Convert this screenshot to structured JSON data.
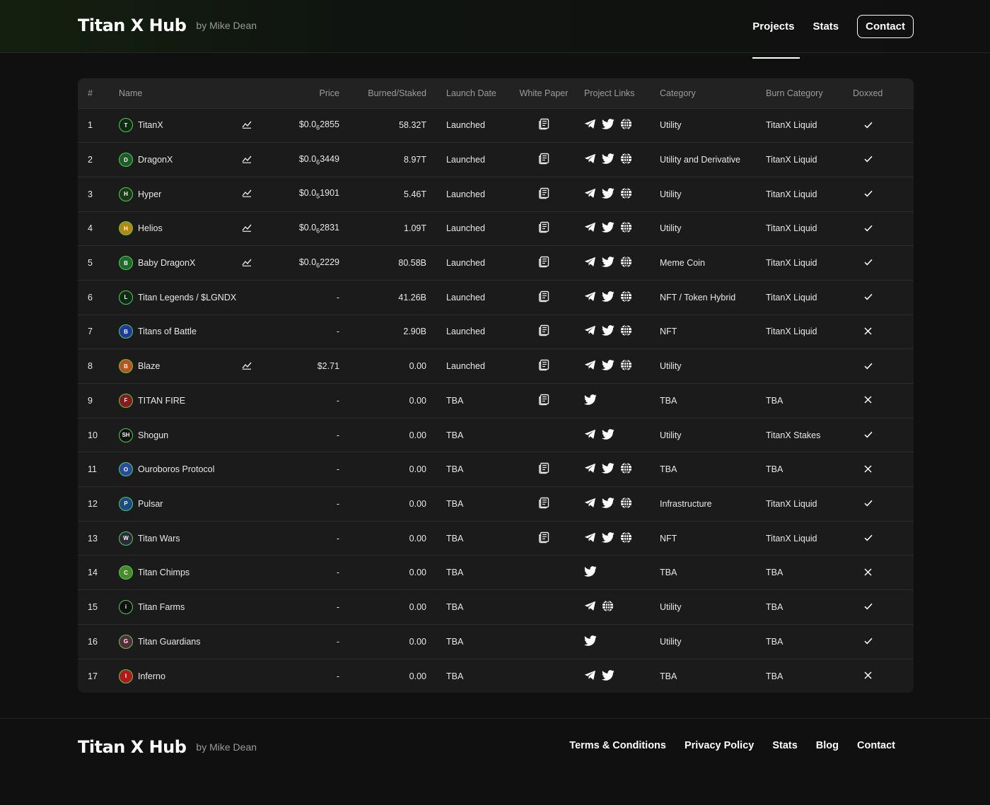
{
  "brand": {
    "name": "Titan X Hub",
    "by": "by Mike Dean"
  },
  "nav": {
    "projects": "Projects",
    "stats": "Stats",
    "contact": "Contact"
  },
  "table": {
    "headers": [
      "#",
      "Name",
      "Price",
      "Burned/Staked",
      "Launch Date",
      "White Paper",
      "Project Links",
      "Category",
      "Burn Category",
      "Doxxed"
    ],
    "rows": [
      {
        "n": "1",
        "name": "TitanX",
        "chart": true,
        "price_html": "$0.0<sub>6</sub>2855",
        "burned": "58.32T",
        "launch": "Launched",
        "wp": true,
        "links": [
          "telegram",
          "twitter",
          "globe"
        ],
        "category": "Utility",
        "burn": "TitanX Liquid",
        "doxxed": true,
        "logo": "T",
        "logo_bg": "#0f2a14"
      },
      {
        "n": "2",
        "name": "DragonX",
        "chart": true,
        "price_html": "$0.0<sub>6</sub>3449",
        "burned": "8.97T",
        "launch": "Launched",
        "wp": true,
        "links": [
          "telegram",
          "twitter",
          "globe"
        ],
        "category": "Utility and Derivative",
        "burn": "TitanX Liquid",
        "doxxed": true,
        "logo": "D",
        "logo_bg": "#1e5a2a"
      },
      {
        "n": "3",
        "name": "Hyper",
        "chart": true,
        "price_html": "$0.0<sub>5</sub>1901",
        "burned": "5.46T",
        "launch": "Launched",
        "wp": true,
        "links": [
          "telegram",
          "twitter",
          "globe"
        ],
        "category": "Utility",
        "burn": "TitanX Liquid",
        "doxxed": true,
        "logo": "H",
        "logo_bg": "#1a3a1a"
      },
      {
        "n": "4",
        "name": "Helios",
        "chart": true,
        "price_html": "$0.0<sub>6</sub>2831",
        "burned": "1.09T",
        "launch": "Launched",
        "wp": true,
        "links": [
          "telegram",
          "twitter",
          "globe"
        ],
        "category": "Utility",
        "burn": "TitanX Liquid",
        "doxxed": true,
        "logo": "H",
        "logo_bg": "#b8860b"
      },
      {
        "n": "5",
        "name": "Baby DragonX",
        "chart": true,
        "price_html": "$0.0<sub>6</sub>2229",
        "burned": "80.58B",
        "launch": "Launched",
        "wp": true,
        "links": [
          "telegram",
          "twitter",
          "globe"
        ],
        "category": "Meme Coin",
        "burn": "TitanX Liquid",
        "doxxed": true,
        "logo": "B",
        "logo_bg": "#1e6a2a"
      },
      {
        "n": "6",
        "name": "Titan Legends / $LGNDX",
        "chart": false,
        "price_html": "-",
        "burned": "41.26B",
        "launch": "Launched",
        "wp": true,
        "links": [
          "telegram",
          "twitter",
          "globe"
        ],
        "category": "NFT / Token Hybrid",
        "burn": "TitanX Liquid",
        "doxxed": true,
        "logo": "L",
        "logo_bg": "#0f2a14"
      },
      {
        "n": "7",
        "name": "Titans of Battle",
        "chart": false,
        "price_html": "-",
        "burned": "2.90B",
        "launch": "Launched",
        "wp": true,
        "links": [
          "telegram",
          "twitter",
          "globe"
        ],
        "category": "NFT",
        "burn": "TitanX Liquid",
        "doxxed": false,
        "logo": "B",
        "logo_bg": "#1e3aa0"
      },
      {
        "n": "8",
        "name": "Blaze",
        "chart": true,
        "price_html": "$2.71",
        "burned": "0.00",
        "launch": "Launched",
        "wp": true,
        "links": [
          "telegram",
          "twitter",
          "globe"
        ],
        "category": "Utility",
        "burn": "",
        "doxxed": true,
        "logo": "B",
        "logo_bg": "#c0501e"
      },
      {
        "n": "9",
        "name": "TITAN FIRE",
        "chart": false,
        "price_html": "-",
        "burned": "0.00",
        "launch": "TBA",
        "wp": true,
        "links": [
          "twitter"
        ],
        "category": "TBA",
        "burn": "TBA",
        "doxxed": false,
        "logo": "F",
        "logo_bg": "#8a1a1a"
      },
      {
        "n": "10",
        "name": "Shogun",
        "chart": false,
        "price_html": "-",
        "burned": "0.00",
        "launch": "TBA",
        "wp": false,
        "links": [
          "telegram",
          "twitter"
        ],
        "category": "Utility",
        "burn": "TitanX Stakes",
        "doxxed": true,
        "logo": "SH",
        "logo_bg": "#101010"
      },
      {
        "n": "11",
        "name": "Ouroboros Protocol",
        "chart": false,
        "price_html": "-",
        "burned": "0.00",
        "launch": "TBA",
        "wp": true,
        "links": [
          "telegram",
          "twitter",
          "globe"
        ],
        "category": "TBA",
        "burn": "TBA",
        "doxxed": false,
        "logo": "O",
        "logo_bg": "#2a4aa0"
      },
      {
        "n": "12",
        "name": "Pulsar",
        "chart": false,
        "price_html": "-",
        "burned": "0.00",
        "launch": "TBA",
        "wp": true,
        "links": [
          "telegram",
          "twitter",
          "globe"
        ],
        "category": "Infrastructure",
        "burn": "TitanX Liquid",
        "doxxed": true,
        "logo": "P",
        "logo_bg": "#1a4a8a"
      },
      {
        "n": "13",
        "name": "Titan Wars",
        "chart": false,
        "price_html": "-",
        "burned": "0.00",
        "launch": "TBA",
        "wp": true,
        "links": [
          "telegram",
          "twitter",
          "globe"
        ],
        "category": "NFT",
        "burn": "TitanX Liquid",
        "doxxed": true,
        "logo": "W",
        "logo_bg": "#2a2a3a"
      },
      {
        "n": "14",
        "name": "Titan Chimps",
        "chart": false,
        "price_html": "-",
        "burned": "0.00",
        "launch": "TBA",
        "wp": false,
        "links": [
          "twitter"
        ],
        "category": "TBA",
        "burn": "TBA",
        "doxxed": false,
        "logo": "C",
        "logo_bg": "#4a8a2a"
      },
      {
        "n": "15",
        "name": "Titan Farms",
        "chart": false,
        "price_html": "-",
        "burned": "0.00",
        "launch": "TBA",
        "wp": false,
        "links": [
          "telegram",
          "globe"
        ],
        "category": "Utility",
        "burn": "TBA",
        "doxxed": true,
        "logo": "i",
        "logo_bg": "#101010"
      },
      {
        "n": "16",
        "name": "Titan Guardians",
        "chart": false,
        "price_html": "-",
        "burned": "0.00",
        "launch": "TBA",
        "wp": false,
        "links": [
          "twitter"
        ],
        "category": "Utility",
        "burn": "TBA",
        "doxxed": true,
        "logo": "G",
        "logo_bg": "#5a2a3a"
      },
      {
        "n": "17",
        "name": "Inferno",
        "chart": false,
        "price_html": "-",
        "burned": "0.00",
        "launch": "TBA",
        "wp": false,
        "links": [
          "telegram",
          "twitter"
        ],
        "category": "TBA",
        "burn": "TBA",
        "doxxed": false,
        "logo": "I",
        "logo_bg": "#b01a1a"
      }
    ]
  },
  "footer": {
    "links": [
      "Terms & Conditions",
      "Privacy Policy",
      "Stats",
      "Blog",
      "Contact"
    ]
  },
  "colors": {
    "accent": "#4bd24b",
    "background": "#101010",
    "panel": "#1b1b1b"
  }
}
